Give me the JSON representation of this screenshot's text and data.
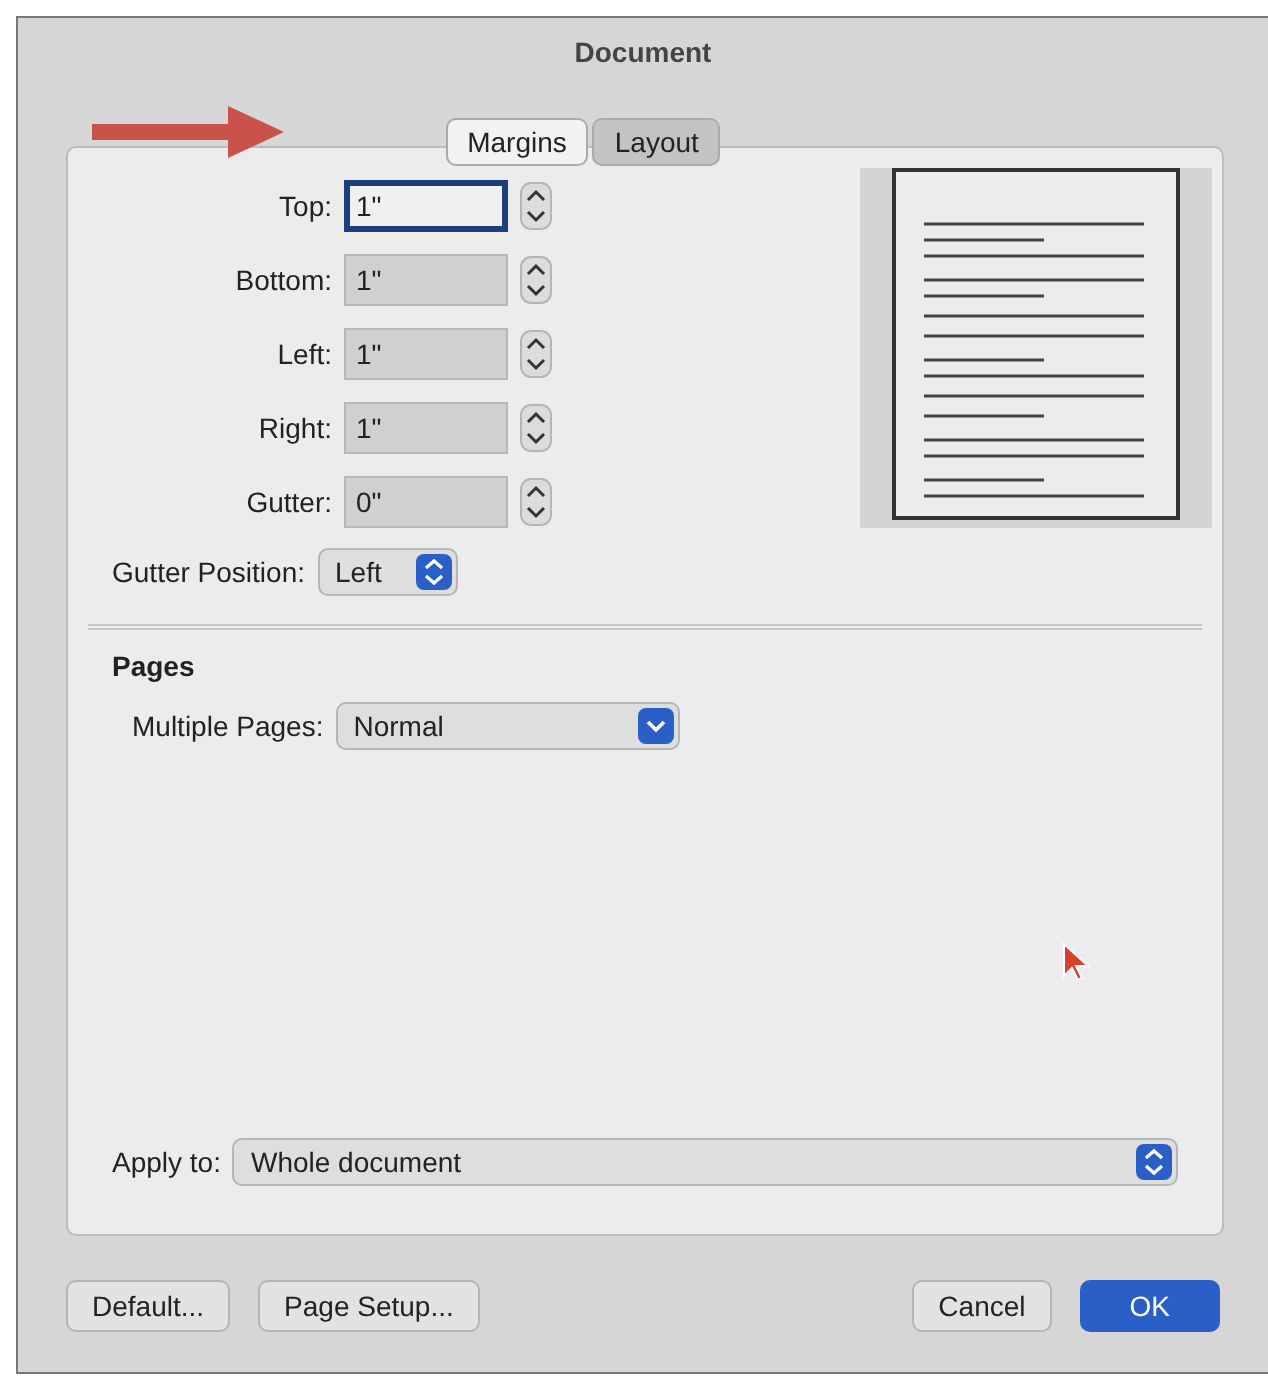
{
  "window": {
    "title": "Document"
  },
  "tabs": [
    {
      "label": "Margins",
      "selected": true
    },
    {
      "label": "Layout",
      "selected": false
    }
  ],
  "margins": [
    {
      "label": "Top:",
      "value": "1\"",
      "focused": true
    },
    {
      "label": "Bottom:",
      "value": "1\"",
      "focused": false
    },
    {
      "label": "Left:",
      "value": "1\"",
      "focused": false
    },
    {
      "label": "Right:",
      "value": "1\"",
      "focused": false
    },
    {
      "label": "Gutter:",
      "value": "0\"",
      "focused": false
    }
  ],
  "gutter_position": {
    "label": "Gutter Position:",
    "value": "Left"
  },
  "pages": {
    "heading": "Pages",
    "label": "Multiple Pages:",
    "value": "Normal"
  },
  "apply_to": {
    "label": "Apply to:",
    "value": "Whole document"
  },
  "buttons": [
    {
      "label": "Default...",
      "kind": "plain"
    },
    {
      "label": "Page Setup...",
      "kind": "plain"
    },
    {
      "label": "Cancel",
      "kind": "plain"
    },
    {
      "label": "OK",
      "kind": "default"
    }
  ]
}
